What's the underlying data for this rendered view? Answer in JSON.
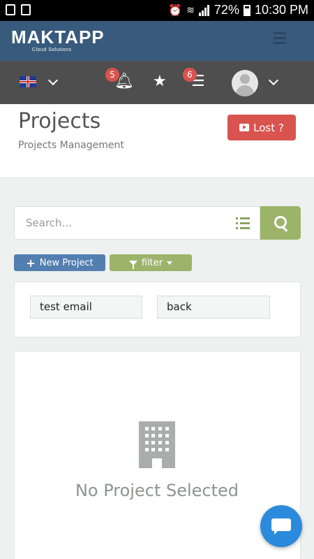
{
  "status_bar": {
    "battery": "72%",
    "time": "10:30 PM"
  },
  "app": {
    "logo_text": "MAKTAPP",
    "logo_tagline": "Cloud Solutions"
  },
  "toolbar": {
    "notifications_count": "5",
    "tasks_count": "6"
  },
  "header": {
    "title": "Projects",
    "subtitle": "Projects Management",
    "lost_button": "Lost ?"
  },
  "search": {
    "placeholder": "Search...",
    "value": ""
  },
  "actions": {
    "new_project": "New Project",
    "filter": "filter"
  },
  "panel": {
    "buttons": [
      "test email",
      "back"
    ]
  },
  "empty_state": {
    "message": "No Project Selected"
  },
  "colors": {
    "appbar": "#385a7c",
    "toolbar": "#4e4e4e",
    "danger": "#d9534f",
    "primary": "#537eb0",
    "success": "#9cb46a",
    "chat": "#2a8bdc"
  },
  "icons": [
    "uk-flag-icon",
    "bell-icon",
    "star-icon",
    "tasks-icon",
    "avatar-icon",
    "search-icon",
    "list-icon",
    "youtube-icon",
    "plus-icon",
    "funnel-icon",
    "building-icon",
    "chat-icon",
    "menu-icon"
  ]
}
